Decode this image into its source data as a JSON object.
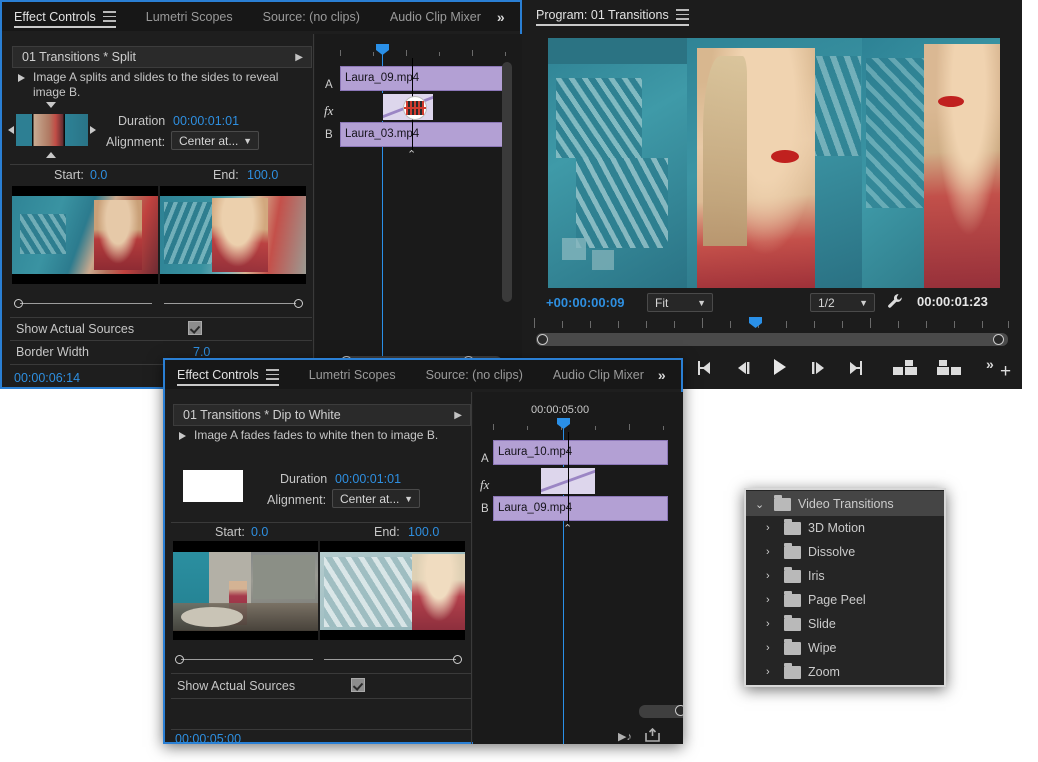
{
  "panel1": {
    "tabs": [
      {
        "label": "Effect Controls",
        "active": true,
        "menu_icon": "hamburger-menu-icon"
      },
      {
        "label": "Lumetri Scopes",
        "active": false
      },
      {
        "label": "Source: (no clips)",
        "active": false
      },
      {
        "label": "Audio Clip Mixer",
        "active": false
      }
    ],
    "overflow_icon": "double-chevron-right-icon",
    "effect_header": "01 Transitions * Split",
    "description": "Image A splits and slides to the sides to reveal image B.",
    "duration_label": "Duration",
    "duration_value": "00:00:01:01",
    "alignment_label": "Alignment:",
    "alignment_value": "Center at...",
    "start_label": "Start:",
    "start_value": "0.0",
    "end_label": "End:",
    "end_value": "100.0",
    "show_actual_sources_label": "Show Actual Sources",
    "show_actual_sources_checked": true,
    "border_width_label": "Border Width",
    "border_width_value": "7.0",
    "timecode": "00:00:06:14",
    "timeline": {
      "track_a_label": "A",
      "track_b_label": "B",
      "fx_label": "fx",
      "clip_a": "Laura_09.mp4",
      "clip_b": "Laura_03.mp4"
    }
  },
  "program": {
    "title": "Program: 01 Transitions",
    "menu_icon": "hamburger-menu-icon",
    "offset_timecode": "+00:00:00:09",
    "zoom_level": "Fit",
    "resolution": "1/2",
    "settings_icon": "wrench-icon",
    "duration_timecode": "00:00:01:23",
    "transport": [
      {
        "name": "mark-in-button",
        "glyph": "mark-in"
      },
      {
        "name": "step-back-button",
        "glyph": "step-back"
      },
      {
        "name": "play-button",
        "glyph": "play"
      },
      {
        "name": "step-forward-button",
        "glyph": "step-forward"
      },
      {
        "name": "mark-out-button",
        "glyph": "mark-out"
      },
      {
        "name": "lift-button",
        "glyph": "lift"
      },
      {
        "name": "extract-button",
        "glyph": "extract"
      }
    ],
    "overflow_icon": "double-chevron-right-icon",
    "add-button": "+"
  },
  "panel2": {
    "tabs": [
      {
        "label": "Effect Controls",
        "active": true,
        "menu_icon": "hamburger-menu-icon"
      },
      {
        "label": "Lumetri Scopes",
        "active": false
      },
      {
        "label": "Source: (no clips)",
        "active": false
      },
      {
        "label": "Audio Clip Mixer",
        "active": false
      }
    ],
    "overflow_icon": "double-chevron-right-icon",
    "effect_header": "01 Transitions * Dip to White",
    "description": "Image A fades fades to white then to image B.",
    "duration_label": "Duration",
    "duration_value": "00:00:01:01",
    "alignment_label": "Alignment:",
    "alignment_value": "Center at...",
    "start_label": "Start:",
    "start_value": "0.0",
    "end_label": "End:",
    "end_value": "100.0",
    "show_actual_sources_label": "Show Actual Sources",
    "show_actual_sources_checked": true,
    "timecode": "00:00:05:00",
    "timeline": {
      "ruler_label": "00:00:05:00",
      "track_a_label": "A",
      "track_b_label": "B",
      "fx_label": "fx",
      "clip_a": "Laura_10.mp4",
      "clip_b": "Laura_09.mp4"
    },
    "footer_icons": [
      "play-audio-icon",
      "export-frame-icon"
    ]
  },
  "effects_tree": {
    "root": {
      "label": "Video Transitions",
      "expanded": true,
      "selected": true,
      "chevron": "chevron-down-icon"
    },
    "items": [
      {
        "label": "3D Motion",
        "chevron": "chevron-right-icon"
      },
      {
        "label": "Dissolve",
        "chevron": "chevron-right-icon"
      },
      {
        "label": "Iris",
        "chevron": "chevron-right-icon"
      },
      {
        "label": "Page Peel",
        "chevron": "chevron-right-icon"
      },
      {
        "label": "Slide",
        "chevron": "chevron-right-icon"
      },
      {
        "label": "Wipe",
        "chevron": "chevron-right-icon"
      },
      {
        "label": "Zoom",
        "chevron": "chevron-right-icon"
      }
    ]
  },
  "colors": {
    "accent_blue": "#2e8fe0",
    "clip_purple": "#b3a0d4",
    "panel_bg": "#1e1e1e",
    "tabbar_bg": "#171717"
  }
}
